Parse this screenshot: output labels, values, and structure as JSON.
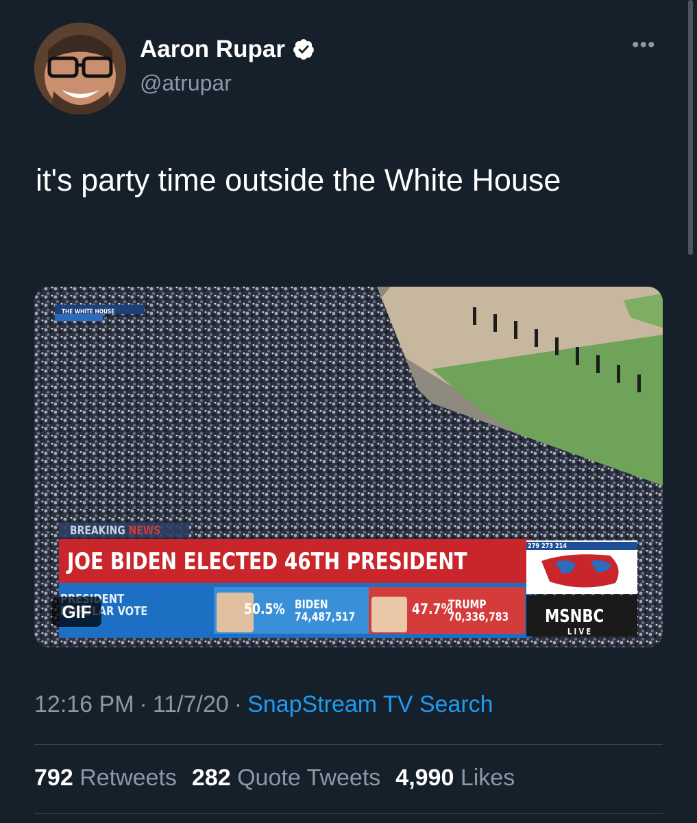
{
  "author": {
    "name": "Aaron Rupar",
    "handle": "@atrupar",
    "verified": true
  },
  "more_icon": "more-horizontal-icon",
  "tweet": {
    "text": "it's party time outside the White House"
  },
  "media": {
    "badge": "GIF",
    "overlay": {
      "location_label": "THE WHITE HOUSE",
      "breaking_label": "BREAKING",
      "breaking_news": "NEWS",
      "headline": "JOE BIDEN ELECTED 46TH PRESIDENT",
      "popular_vote_label_1": "PRESIDENT",
      "popular_vote_label_2": "POPULAR VOTE",
      "biden_pct": "50.5%",
      "biden_name": "BIDEN",
      "biden_votes": "74,487,517",
      "trump_pct": "47.7%",
      "trump_name": "TRUMP",
      "trump_votes": "70,336,783",
      "network": "MSNBC",
      "network_live": "LIVE",
      "electoral_map_numbers": "279   273   214"
    }
  },
  "meta": {
    "time": "12:16 PM",
    "date": "11/7/20",
    "separator": "·",
    "source": "SnapStream TV Search"
  },
  "stats": {
    "retweets_count": "792",
    "retweets_label": "Retweets",
    "quotes_count": "282",
    "quotes_label": "Quote Tweets",
    "likes_count": "4,990",
    "likes_label": "Likes"
  },
  "colors": {
    "background": "#15202b",
    "secondary_text": "#8b98a5",
    "link": "#1d9bf0",
    "divider": "#38444d"
  }
}
